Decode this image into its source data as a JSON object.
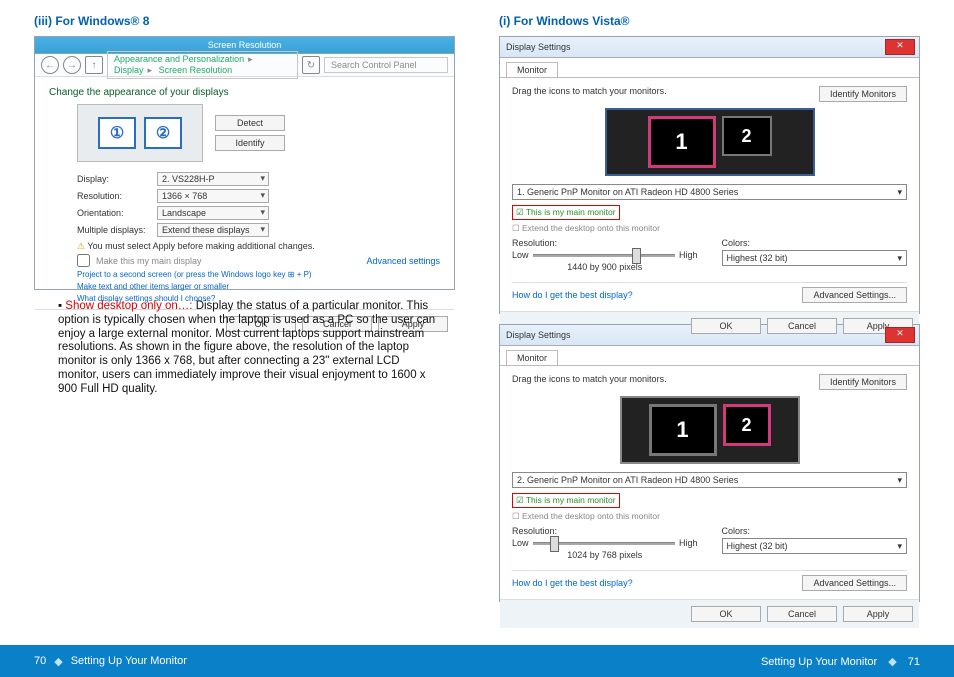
{
  "left": {
    "heading": "(iii)  For Windows® 8",
    "win8": {
      "title": "Screen Resolution",
      "breadcrumb": [
        "Appearance and Personalization",
        "Display",
        "Screen Resolution"
      ],
      "search_placeholder": "Search Control Panel",
      "page_heading": "Change the appearance of your displays",
      "btn_detect": "Detect",
      "btn_identify": "Identify",
      "fields": {
        "display_label": "Display:",
        "display_value": "2. VS228H-P",
        "resolution_label": "Resolution:",
        "resolution_value": "1366 × 768",
        "orientation_label": "Orientation:",
        "orientation_value": "Landscape",
        "multiple_label": "Multiple displays:",
        "multiple_value": "Extend these displays"
      },
      "warning": "You must select Apply before making additional changes.",
      "make_main": "Make this my main display",
      "advanced": "Advanced settings",
      "link1": "Project to a second screen (or press the Windows logo key ⊞ + P)",
      "link2": "Make text and other items larger or smaller",
      "link3": "What display settings should I choose?",
      "btn_ok": "OK",
      "btn_cancel": "Cancel",
      "btn_apply": "Apply"
    },
    "para_lead": "Show desktop only on…:",
    "para_body": " Display the status of a particular monitor. This option is typically chosen when the laptop is used as a PC so the user can enjoy a large external monitor. Most current laptops support mainstream resolutions. As shown in the figure above, the resolution of the laptop monitor is only 1366 x 768, but after connecting a 23\" external LCD monitor, users can immediately improve their visual enjoyment to 1600 x 900 Full HD quality."
  },
  "right": {
    "heading": "(i)  For Windows Vista®",
    "vista": {
      "title": "Display Settings",
      "tab": "Monitor",
      "drag_text": "Drag the icons to match your monitors.",
      "identify": "Identify Monitors",
      "sel1": "1. Generic PnP Monitor on ATI Radeon HD 4800 Series",
      "sel2": "2. Generic PnP Monitor on ATI Radeon HD 4800 Series",
      "chk_main": "This is my main monitor",
      "chk_extend": "Extend the desktop onto this monitor",
      "res_label": "Resolution:",
      "low": "Low",
      "high": "High",
      "res1": "1440 by 900 pixels",
      "res2": "1024 by 768 pixels",
      "colors_label": "Colors:",
      "colors_value": "Highest (32 bit)",
      "help": "How do I get the best display?",
      "adv": "Advanced Settings...",
      "ok": "OK",
      "cancel": "Cancel",
      "apply": "Apply"
    }
  },
  "footer": {
    "left_page": "70",
    "right_page": "71",
    "section": "Setting Up Your Monitor"
  }
}
